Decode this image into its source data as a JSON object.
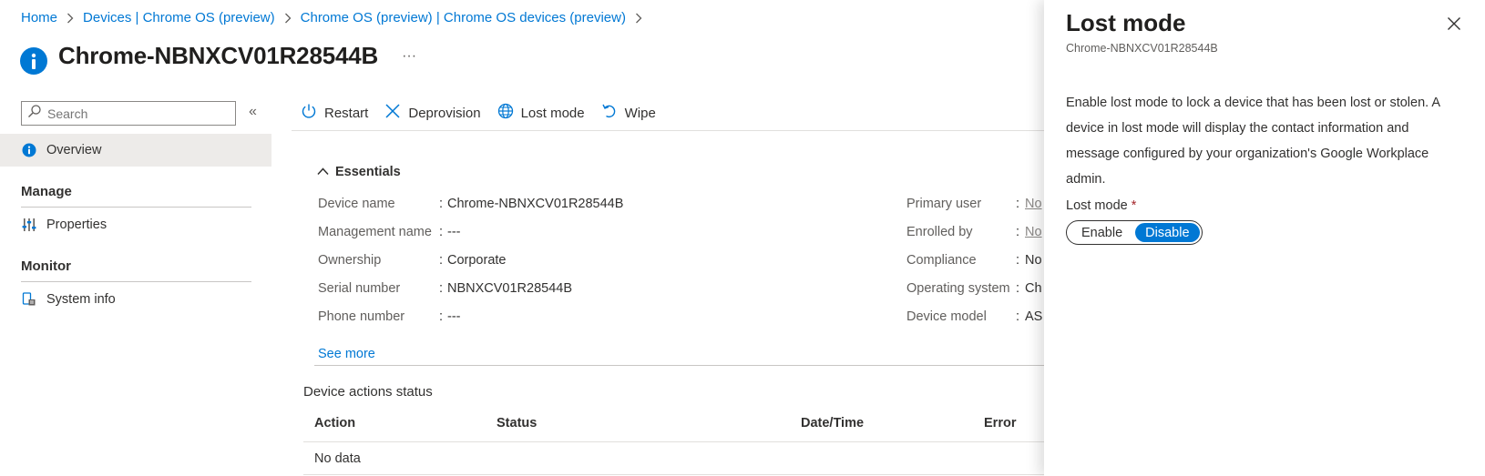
{
  "breadcrumb": [
    "Home",
    "Devices | Chrome OS (preview)",
    "Chrome OS (preview) | Chrome OS devices (preview)"
  ],
  "page": {
    "title": "Chrome-NBNXCV01R28544B",
    "more": "···"
  },
  "nav": {
    "search_placeholder": "Search",
    "collapse": "«",
    "overview": "Overview",
    "manage": "Manage",
    "properties": "Properties",
    "monitor": "Monitor",
    "system_info": "System info"
  },
  "toolbar": {
    "restart": "Restart",
    "deprovision": "Deprovision",
    "lost_mode": "Lost mode",
    "wipe": "Wipe"
  },
  "essentials": {
    "header": "Essentials",
    "left": [
      {
        "label": "Device name",
        "value": "Chrome-NBNXCV01R28544B"
      },
      {
        "label": "Management name",
        "value": "---"
      },
      {
        "label": "Ownership",
        "value": "Corporate"
      },
      {
        "label": "Serial number",
        "value": "NBNXCV01R28544B"
      },
      {
        "label": "Phone number",
        "value": "---"
      }
    ],
    "right": [
      {
        "label": "Primary user",
        "value": "No"
      },
      {
        "label": "Enrolled by",
        "value": "No"
      },
      {
        "label": "Compliance",
        "value": "No"
      },
      {
        "label": "Operating system",
        "value": "Ch"
      },
      {
        "label": "Device model",
        "value": "AS"
      }
    ],
    "colon": ":",
    "see_more": "See more"
  },
  "device_actions": {
    "title": "Device actions status",
    "columns": [
      "Action",
      "Status",
      "Date/Time",
      "Error"
    ],
    "empty": "No data"
  },
  "panel": {
    "title": "Lost mode",
    "subtitle": "Chrome-NBNXCV01R28544B",
    "description": "Enable lost mode to lock a device that has been lost or stolen. A device in lost mode will display the contact information and message configured by your organization's Google Workplace admin.",
    "field_label": "Lost mode",
    "required_mark": "*",
    "toggle": {
      "enable": "Enable",
      "disable": "Disable",
      "selected": "Disable"
    }
  },
  "colors": {
    "accent": "#0078d4",
    "text": "#323130",
    "muted": "#605e5c",
    "required": "#a4262c"
  }
}
